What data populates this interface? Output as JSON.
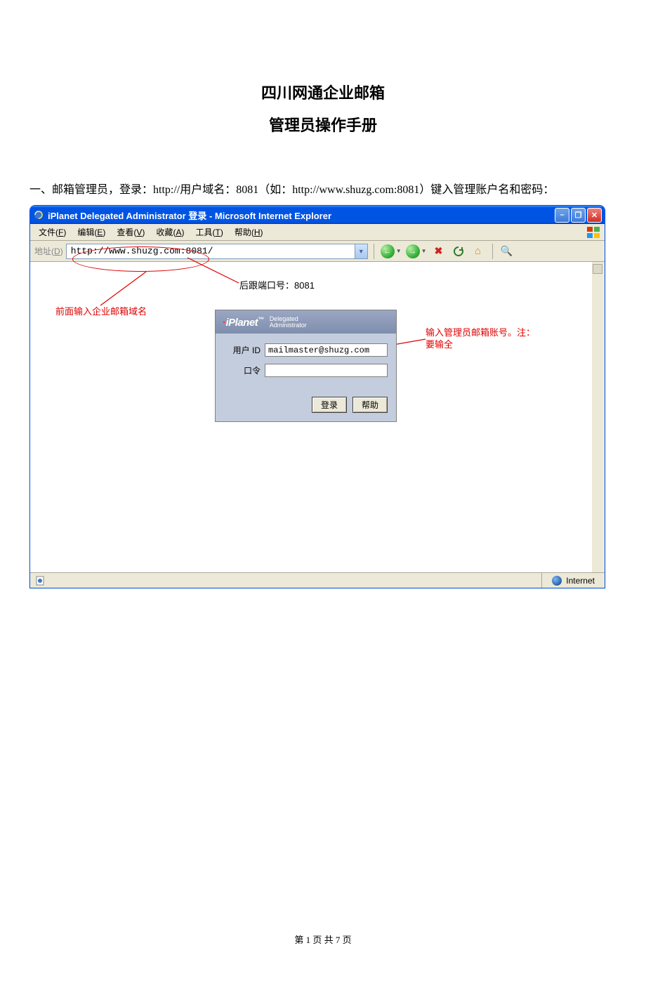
{
  "doc": {
    "title": "四川网通企业邮箱",
    "subtitle": "管理员操作手册",
    "paragraph": "一、邮箱管理员，登录：http://用户域名：8081（如：http://www.shuzg.com:8081）键入管理账户名和密码：",
    "footer": "第 1 页 共 7 页"
  },
  "browser": {
    "window_title": "iPlanet Delegated Administrator 登录 - Microsoft Internet Explorer",
    "menus": [
      {
        "label": "文件",
        "hotkey": "F"
      },
      {
        "label": "编辑",
        "hotkey": "E"
      },
      {
        "label": "查看",
        "hotkey": "V"
      },
      {
        "label": "收藏",
        "hotkey": "A"
      },
      {
        "label": "工具",
        "hotkey": "T"
      },
      {
        "label": "帮助",
        "hotkey": "H"
      }
    ],
    "address_label": "地址",
    "address_hotkey": "D",
    "address_value": "http://www.shuzg.com:8081/",
    "statusbar_zone": "Internet"
  },
  "login": {
    "brand": "iPlanet",
    "brand_sub1": "Delegated",
    "brand_sub2": "Administrator",
    "userid_label": "用户 ID",
    "userid_value": "mailmaster@shuzg.com",
    "password_label": "口令",
    "btn_login": "登录",
    "btn_help": "帮助"
  },
  "annotations": {
    "domain_note": "前面输入企业邮箱域名",
    "port_note": "后跟端口号：8081",
    "account_note": "输入管理员邮箱账号。注：要输全"
  }
}
